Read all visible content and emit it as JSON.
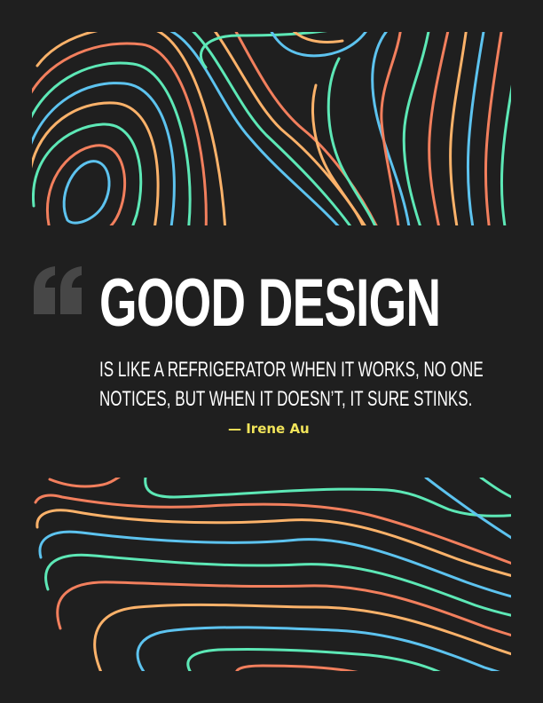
{
  "quote": {
    "headline": "GOOD DESIGN",
    "line_1": "IS LIKE A REFRIGERATOR WHEN IT WORKS, NO ONE",
    "line_2": "NOTICES, BUT WHEN IT DOESN’T, IT SURE STINKS.",
    "attribution": "— Irene Au"
  },
  "colors": {
    "background": "#1f1f1f",
    "text": "#ffffff",
    "attribution": "#f1e45a",
    "quote_mark": "#474747",
    "line_palette": [
      "#f27f5d",
      "#fbb26a",
      "#5dc3ef",
      "#5de8b6"
    ]
  },
  "decoration": {
    "top_panel": "topographic-contour-lines",
    "bottom_panel": "topographic-contour-lines"
  }
}
